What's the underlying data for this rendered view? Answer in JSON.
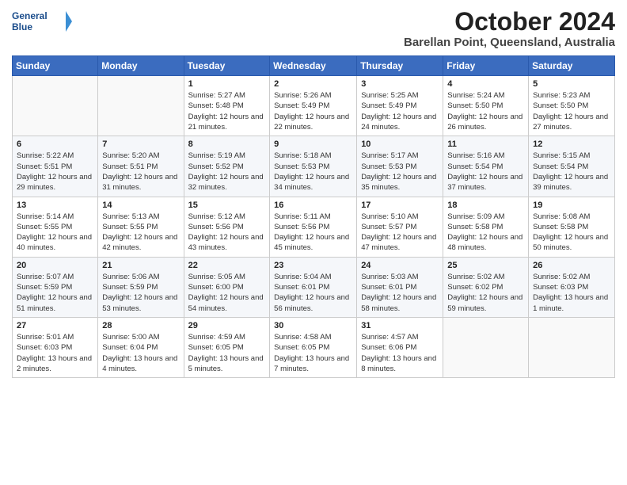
{
  "header": {
    "logo_line1": "General",
    "logo_line2": "Blue",
    "month": "October 2024",
    "location": "Barellan Point, Queensland, Australia"
  },
  "weekdays": [
    "Sunday",
    "Monday",
    "Tuesday",
    "Wednesday",
    "Thursday",
    "Friday",
    "Saturday"
  ],
  "weeks": [
    [
      {
        "day": "",
        "sunrise": "",
        "sunset": "",
        "daylight": ""
      },
      {
        "day": "",
        "sunrise": "",
        "sunset": "",
        "daylight": ""
      },
      {
        "day": "1",
        "sunrise": "Sunrise: 5:27 AM",
        "sunset": "Sunset: 5:48 PM",
        "daylight": "Daylight: 12 hours and 21 minutes."
      },
      {
        "day": "2",
        "sunrise": "Sunrise: 5:26 AM",
        "sunset": "Sunset: 5:49 PM",
        "daylight": "Daylight: 12 hours and 22 minutes."
      },
      {
        "day": "3",
        "sunrise": "Sunrise: 5:25 AM",
        "sunset": "Sunset: 5:49 PM",
        "daylight": "Daylight: 12 hours and 24 minutes."
      },
      {
        "day": "4",
        "sunrise": "Sunrise: 5:24 AM",
        "sunset": "Sunset: 5:50 PM",
        "daylight": "Daylight: 12 hours and 26 minutes."
      },
      {
        "day": "5",
        "sunrise": "Sunrise: 5:23 AM",
        "sunset": "Sunset: 5:50 PM",
        "daylight": "Daylight: 12 hours and 27 minutes."
      }
    ],
    [
      {
        "day": "6",
        "sunrise": "Sunrise: 5:22 AM",
        "sunset": "Sunset: 5:51 PM",
        "daylight": "Daylight: 12 hours and 29 minutes."
      },
      {
        "day": "7",
        "sunrise": "Sunrise: 5:20 AM",
        "sunset": "Sunset: 5:51 PM",
        "daylight": "Daylight: 12 hours and 31 minutes."
      },
      {
        "day": "8",
        "sunrise": "Sunrise: 5:19 AM",
        "sunset": "Sunset: 5:52 PM",
        "daylight": "Daylight: 12 hours and 32 minutes."
      },
      {
        "day": "9",
        "sunrise": "Sunrise: 5:18 AM",
        "sunset": "Sunset: 5:53 PM",
        "daylight": "Daylight: 12 hours and 34 minutes."
      },
      {
        "day": "10",
        "sunrise": "Sunrise: 5:17 AM",
        "sunset": "Sunset: 5:53 PM",
        "daylight": "Daylight: 12 hours and 35 minutes."
      },
      {
        "day": "11",
        "sunrise": "Sunrise: 5:16 AM",
        "sunset": "Sunset: 5:54 PM",
        "daylight": "Daylight: 12 hours and 37 minutes."
      },
      {
        "day": "12",
        "sunrise": "Sunrise: 5:15 AM",
        "sunset": "Sunset: 5:54 PM",
        "daylight": "Daylight: 12 hours and 39 minutes."
      }
    ],
    [
      {
        "day": "13",
        "sunrise": "Sunrise: 5:14 AM",
        "sunset": "Sunset: 5:55 PM",
        "daylight": "Daylight: 12 hours and 40 minutes."
      },
      {
        "day": "14",
        "sunrise": "Sunrise: 5:13 AM",
        "sunset": "Sunset: 5:55 PM",
        "daylight": "Daylight: 12 hours and 42 minutes."
      },
      {
        "day": "15",
        "sunrise": "Sunrise: 5:12 AM",
        "sunset": "Sunset: 5:56 PM",
        "daylight": "Daylight: 12 hours and 43 minutes."
      },
      {
        "day": "16",
        "sunrise": "Sunrise: 5:11 AM",
        "sunset": "Sunset: 5:56 PM",
        "daylight": "Daylight: 12 hours and 45 minutes."
      },
      {
        "day": "17",
        "sunrise": "Sunrise: 5:10 AM",
        "sunset": "Sunset: 5:57 PM",
        "daylight": "Daylight: 12 hours and 47 minutes."
      },
      {
        "day": "18",
        "sunrise": "Sunrise: 5:09 AM",
        "sunset": "Sunset: 5:58 PM",
        "daylight": "Daylight: 12 hours and 48 minutes."
      },
      {
        "day": "19",
        "sunrise": "Sunrise: 5:08 AM",
        "sunset": "Sunset: 5:58 PM",
        "daylight": "Daylight: 12 hours and 50 minutes."
      }
    ],
    [
      {
        "day": "20",
        "sunrise": "Sunrise: 5:07 AM",
        "sunset": "Sunset: 5:59 PM",
        "daylight": "Daylight: 12 hours and 51 minutes."
      },
      {
        "day": "21",
        "sunrise": "Sunrise: 5:06 AM",
        "sunset": "Sunset: 5:59 PM",
        "daylight": "Daylight: 12 hours and 53 minutes."
      },
      {
        "day": "22",
        "sunrise": "Sunrise: 5:05 AM",
        "sunset": "Sunset: 6:00 PM",
        "daylight": "Daylight: 12 hours and 54 minutes."
      },
      {
        "day": "23",
        "sunrise": "Sunrise: 5:04 AM",
        "sunset": "Sunset: 6:01 PM",
        "daylight": "Daylight: 12 hours and 56 minutes."
      },
      {
        "day": "24",
        "sunrise": "Sunrise: 5:03 AM",
        "sunset": "Sunset: 6:01 PM",
        "daylight": "Daylight: 12 hours and 58 minutes."
      },
      {
        "day": "25",
        "sunrise": "Sunrise: 5:02 AM",
        "sunset": "Sunset: 6:02 PM",
        "daylight": "Daylight: 12 hours and 59 minutes."
      },
      {
        "day": "26",
        "sunrise": "Sunrise: 5:02 AM",
        "sunset": "Sunset: 6:03 PM",
        "daylight": "Daylight: 13 hours and 1 minute."
      }
    ],
    [
      {
        "day": "27",
        "sunrise": "Sunrise: 5:01 AM",
        "sunset": "Sunset: 6:03 PM",
        "daylight": "Daylight: 13 hours and 2 minutes."
      },
      {
        "day": "28",
        "sunrise": "Sunrise: 5:00 AM",
        "sunset": "Sunset: 6:04 PM",
        "daylight": "Daylight: 13 hours and 4 minutes."
      },
      {
        "day": "29",
        "sunrise": "Sunrise: 4:59 AM",
        "sunset": "Sunset: 6:05 PM",
        "daylight": "Daylight: 13 hours and 5 minutes."
      },
      {
        "day": "30",
        "sunrise": "Sunrise: 4:58 AM",
        "sunset": "Sunset: 6:05 PM",
        "daylight": "Daylight: 13 hours and 7 minutes."
      },
      {
        "day": "31",
        "sunrise": "Sunrise: 4:57 AM",
        "sunset": "Sunset: 6:06 PM",
        "daylight": "Daylight: 13 hours and 8 minutes."
      },
      {
        "day": "",
        "sunrise": "",
        "sunset": "",
        "daylight": ""
      },
      {
        "day": "",
        "sunrise": "",
        "sunset": "",
        "daylight": ""
      }
    ]
  ]
}
